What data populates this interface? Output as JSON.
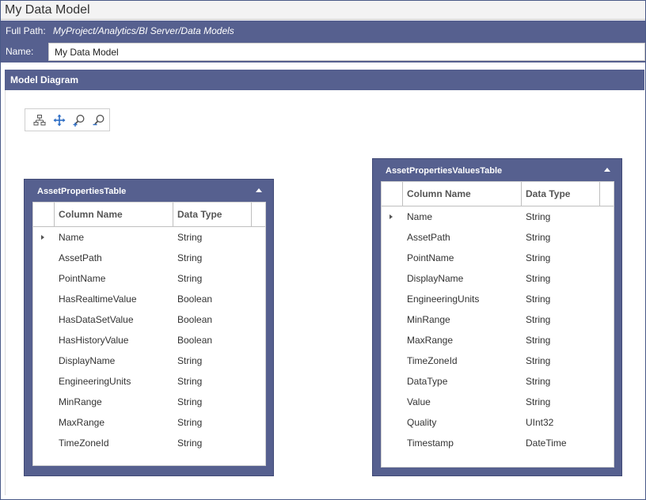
{
  "window": {
    "title": "My Data Model"
  },
  "path_bar": {
    "label": "Full Path:",
    "value": "MyProject/Analytics/BI Server/Data Models"
  },
  "name_field": {
    "label": "Name:",
    "value": "My Data Model"
  },
  "model_diagram": {
    "header": "Model Diagram",
    "toolbar": [
      {
        "icon": "auto-layout-icon"
      },
      {
        "icon": "pan-icon"
      },
      {
        "icon": "zoom-in-icon"
      },
      {
        "icon": "zoom-out-icon"
      }
    ]
  },
  "tables": [
    {
      "name": "AssetPropertiesTable",
      "columns": [
        "Column Name",
        "Data Type"
      ],
      "rows": [
        [
          "Name",
          "String"
        ],
        [
          "AssetPath",
          "String"
        ],
        [
          "PointName",
          "String"
        ],
        [
          "HasRealtimeValue",
          "Boolean"
        ],
        [
          "HasDataSetValue",
          "Boolean"
        ],
        [
          "HasHistoryValue",
          "Boolean"
        ],
        [
          "DisplayName",
          "String"
        ],
        [
          "EngineeringUnits",
          "String"
        ],
        [
          "MinRange",
          "String"
        ],
        [
          "MaxRange",
          "String"
        ],
        [
          "TimeZoneId",
          "String"
        ]
      ]
    },
    {
      "name": "AssetPropertiesValuesTable",
      "columns": [
        "Column Name",
        "Data Type"
      ],
      "rows": [
        [
          "Name",
          "String"
        ],
        [
          "AssetPath",
          "String"
        ],
        [
          "PointName",
          "String"
        ],
        [
          "DisplayName",
          "String"
        ],
        [
          "EngineeringUnits",
          "String"
        ],
        [
          "MinRange",
          "String"
        ],
        [
          "MaxRange",
          "String"
        ],
        [
          "TimeZoneId",
          "String"
        ],
        [
          "DataType",
          "String"
        ],
        [
          "Value",
          "String"
        ],
        [
          "Quality",
          "UInt32"
        ],
        [
          "Timestamp",
          "DateTime"
        ]
      ]
    }
  ],
  "colors": {
    "accent": "#56608f",
    "accent_dark": "#414a76"
  }
}
